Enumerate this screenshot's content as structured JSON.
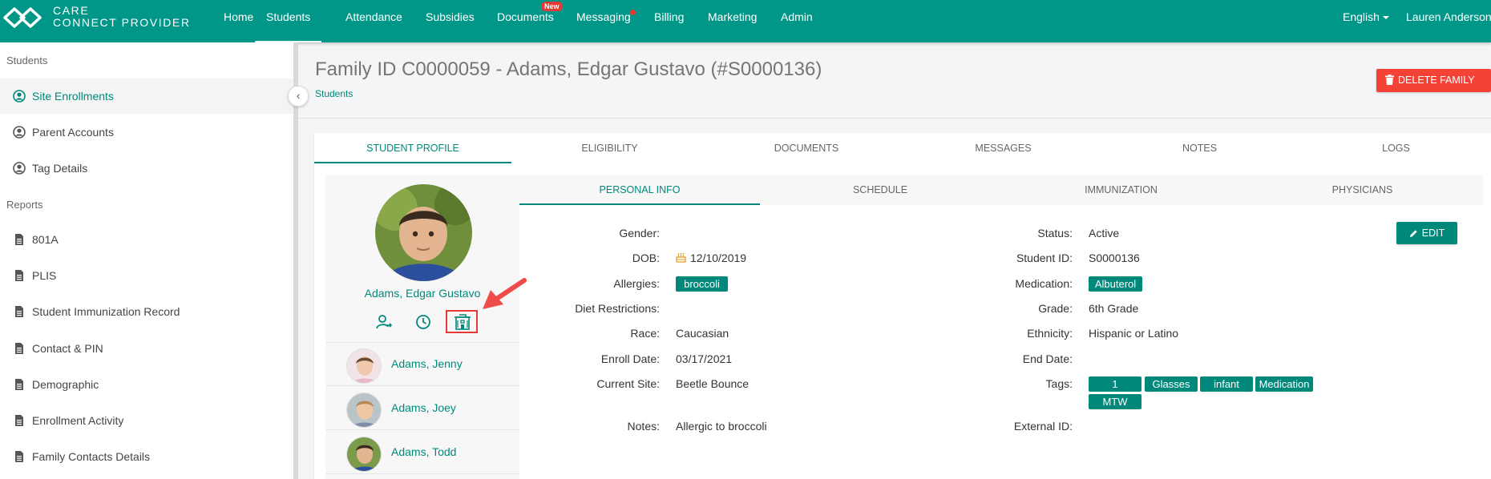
{
  "brand": {
    "line1": "CARE",
    "line2": "CONNECT PROVIDER"
  },
  "nav": {
    "items": [
      "Home",
      "Students",
      "Attendance",
      "Subsidies",
      "Documents",
      "Messaging",
      "Billing",
      "Marketing",
      "Admin"
    ],
    "active": "Students",
    "documents_badge": "New",
    "language": "English",
    "user": "Lauren Anderson"
  },
  "sidebar": {
    "students_heading": "Students",
    "student_items": [
      "Site Enrollments",
      "Parent Accounts",
      "Tag Details"
    ],
    "reports_heading": "Reports",
    "report_items": [
      "801A",
      "PLIS",
      "Student Immunization Record",
      "Contact & PIN",
      "Demographic",
      "Enrollment Activity",
      "Family Contacts Details"
    ]
  },
  "header": {
    "title": "Family ID C0000059 - Adams, Edgar Gustavo (#S0000136)",
    "breadcrumb": "Students",
    "delete_label": "DELETE FAMILY"
  },
  "tabs": [
    "STUDENT PROFILE",
    "ELIGIBILITY",
    "DOCUMENTS",
    "MESSAGES",
    "NOTES",
    "LOGS"
  ],
  "subtabs": [
    "PERSONAL INFO",
    "SCHEDULE",
    "IMMUNIZATION",
    "PHYSICIANS"
  ],
  "student": {
    "name": "Adams, Edgar Gustavo",
    "siblings": [
      "Adams, Jenny",
      "Adams, Joey",
      "Adams, Todd"
    ]
  },
  "personal": {
    "labels": {
      "gender": "Gender:",
      "dob": "DOB:",
      "allergies": "Allergies:",
      "diet": "Diet Restrictions:",
      "race": "Race:",
      "enroll": "Enroll Date:",
      "site": "Current Site:",
      "notes": "Notes:",
      "status": "Status:",
      "student_id": "Student ID:",
      "medication": "Medication:",
      "grade": "Grade:",
      "ethnicity": "Ethnicity:",
      "end": "End Date:",
      "tags": "Tags:",
      "external": "External ID:"
    },
    "dob": "12/10/2019",
    "allergies": [
      "broccoli"
    ],
    "race": "Caucasian",
    "enroll_date": "03/17/2021",
    "current_site": "Beetle Bounce",
    "notes": "Allergic to broccoli",
    "status": "Active",
    "student_id": "S0000136",
    "medication": [
      "Albuterol"
    ],
    "grade": "6th Grade",
    "ethnicity": "Hispanic or Latino",
    "tags": [
      "1",
      "Glasses",
      "infant",
      "Medication",
      "MTW"
    ],
    "edit_label": "EDIT"
  },
  "colors": {
    "primary": "#009788",
    "accent": "#00897b",
    "danger": "#f44336"
  }
}
